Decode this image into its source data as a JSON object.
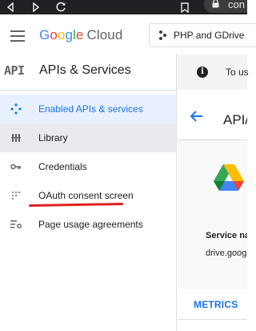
{
  "browser": {
    "url_fragment": "con"
  },
  "header": {
    "logo": {
      "google_letters": [
        "G",
        "o",
        "o",
        "g",
        "l",
        "e"
      ],
      "product": "Cloud"
    },
    "project_selector": "PHP and GDrive"
  },
  "sidebar": {
    "badge": "API",
    "title": "APIs & Services",
    "items": [
      {
        "label": "Enabled APIs & services",
        "icon": "diamond-api-icon",
        "active": true
      },
      {
        "label": "Library",
        "icon": "library-icon",
        "hover": true
      },
      {
        "label": "Credentials",
        "icon": "key-icon"
      },
      {
        "label": "OAuth consent screen",
        "icon": "consent-icon"
      },
      {
        "label": "Page usage agreements",
        "icon": "settings-list-icon"
      }
    ]
  },
  "info_bar": {
    "icon": "info-icon",
    "text": "To us"
  },
  "content": {
    "title": "API/",
    "service_name_label": "Service na",
    "service_name_value": "drive.goog",
    "tabs": [
      {
        "label": "METRICS",
        "active": true
      }
    ]
  },
  "colors": {
    "accent": "#1a73e8",
    "active_bg": "#e8f0fe",
    "annotation_underline": "#e02020"
  }
}
